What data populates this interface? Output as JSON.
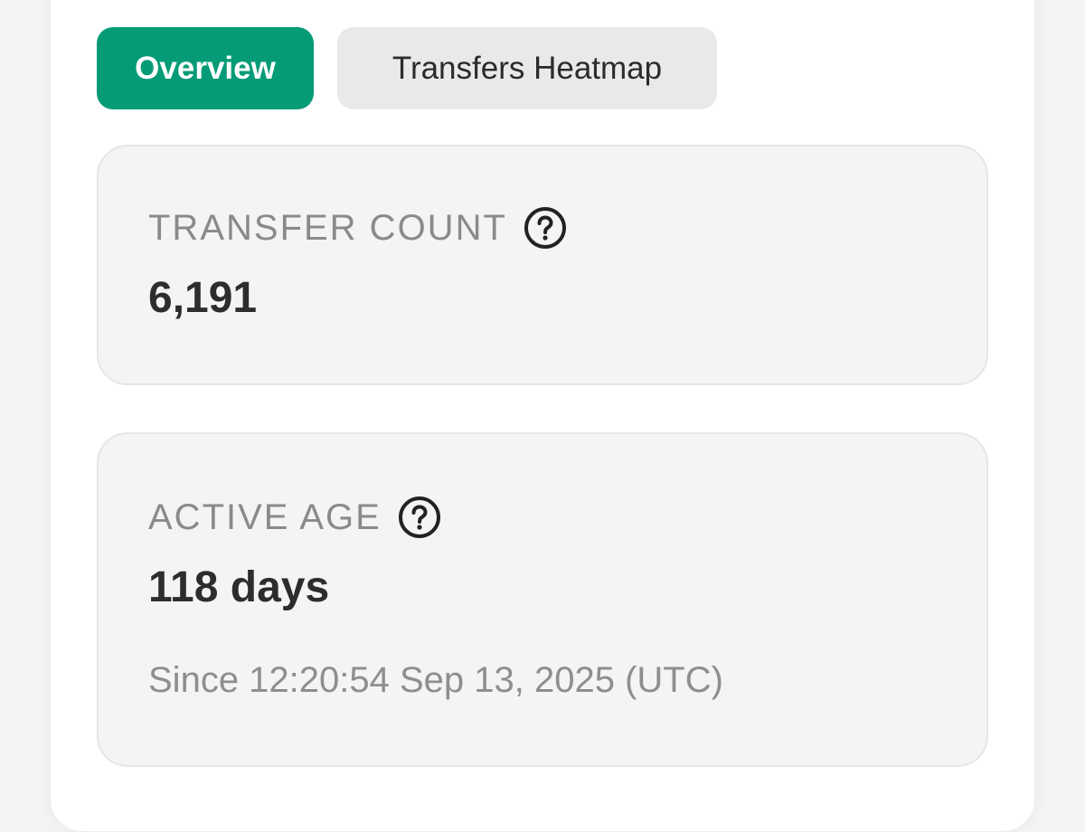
{
  "tabs": [
    {
      "label": "Overview",
      "active": true
    },
    {
      "label": "Transfers Heatmap",
      "active": false
    }
  ],
  "stats": {
    "transfer_count": {
      "label": "TRANSFER COUNT",
      "value": "6,191",
      "icon": "help-circle-icon"
    },
    "active_age": {
      "label": "ACTIVE AGE",
      "value": "118 days",
      "since": "Since 12:20:54 Sep 13, 2025 (UTC)",
      "icon": "help-circle-icon"
    }
  },
  "colors": {
    "accent": "#059b76",
    "tab_inactive_bg": "#e9e9ea",
    "card_bg": "#f4f4f5",
    "label_text": "#8a8a8a",
    "value_text": "#2d2d2d"
  }
}
